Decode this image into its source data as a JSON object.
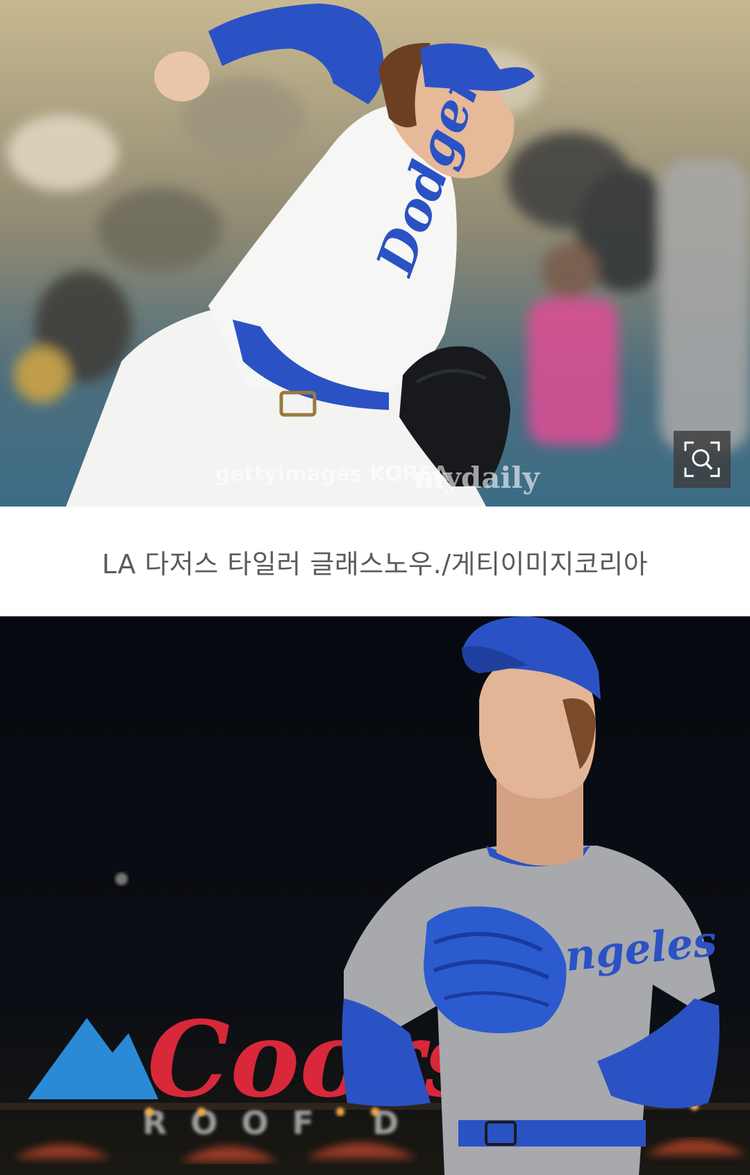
{
  "photo1": {
    "alt": "LA 다저스 타일러 글래스노우 투구",
    "jersey_text": "Dodgers",
    "watermark_getty": "gettyimages KOREA",
    "watermark_mydaily": "mydaily"
  },
  "zoom": {
    "icon": "magnifier-zoom-icon"
  },
  "caption": {
    "text": "LA 다저스 타일러 글래스노우./게티이미지코리아"
  },
  "photo2": {
    "alt": "LA 다저스 투수 원정 유니폼",
    "jersey_text": "Angeles",
    "sign_text": "Coors",
    "sign_sub": "ROOF D"
  },
  "colors": {
    "dodger_blue": "#2b52c4",
    "coors_red": "#d8283a",
    "caption_text": "#5b5b5b"
  }
}
